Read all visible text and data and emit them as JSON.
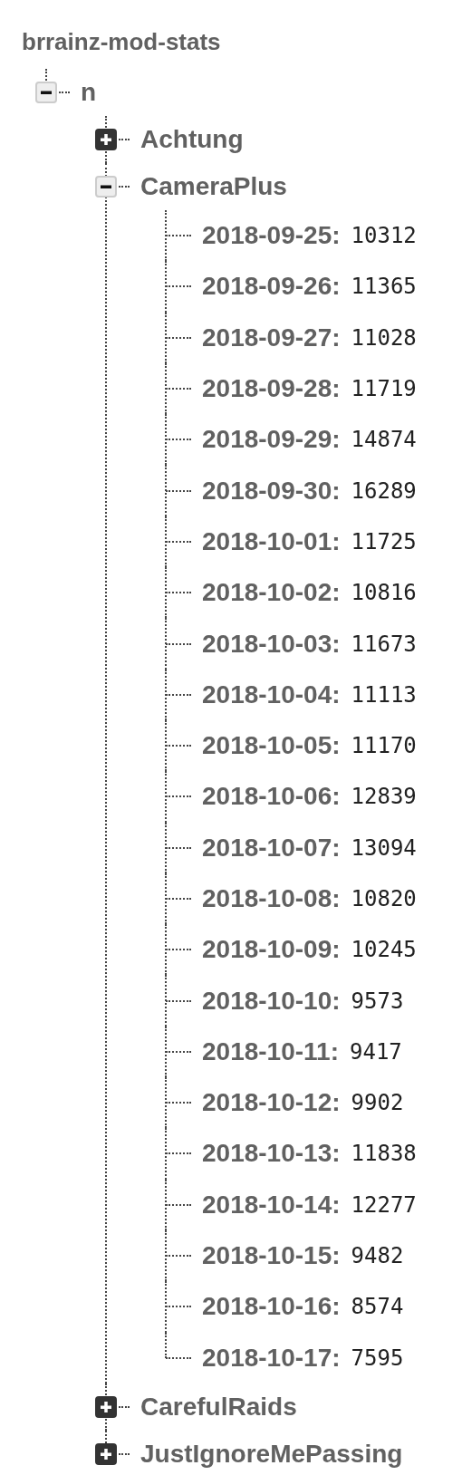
{
  "title": "brrainz-mod-stats",
  "nodes": [
    {
      "key": "n",
      "expanded": true,
      "children": [
        {
          "key": "Achtung",
          "expanded": false
        },
        {
          "key": "CameraPlus",
          "expanded": true,
          "children": [
            {
              "key": "2018-09-25:",
              "value": "10312"
            },
            {
              "key": "2018-09-26:",
              "value": "11365"
            },
            {
              "key": "2018-09-27:",
              "value": "11028"
            },
            {
              "key": "2018-09-28:",
              "value": "11719"
            },
            {
              "key": "2018-09-29:",
              "value": "14874"
            },
            {
              "key": "2018-09-30:",
              "value": "16289"
            },
            {
              "key": "2018-10-01:",
              "value": "11725"
            },
            {
              "key": "2018-10-02:",
              "value": "10816"
            },
            {
              "key": "2018-10-03:",
              "value": "11673"
            },
            {
              "key": "2018-10-04:",
              "value": "11113"
            },
            {
              "key": "2018-10-05:",
              "value": "11170"
            },
            {
              "key": "2018-10-06:",
              "value": "12839"
            },
            {
              "key": "2018-10-07:",
              "value": "13094"
            },
            {
              "key": "2018-10-08:",
              "value": "10820"
            },
            {
              "key": "2018-10-09:",
              "value": "10245"
            },
            {
              "key": "2018-10-10:",
              "value": "9573"
            },
            {
              "key": "2018-10-11:",
              "value": "9417"
            },
            {
              "key": "2018-10-12:",
              "value": "9902"
            },
            {
              "key": "2018-10-13:",
              "value": "11838"
            },
            {
              "key": "2018-10-14:",
              "value": "12277"
            },
            {
              "key": "2018-10-15:",
              "value": "9482"
            },
            {
              "key": "2018-10-16:",
              "value": "8574"
            },
            {
              "key": "2018-10-17:",
              "value": "7595"
            }
          ]
        },
        {
          "key": "CarefulRaids",
          "expanded": false
        },
        {
          "key": "JustIgnoreMePassing",
          "expanded": false
        }
      ]
    }
  ]
}
